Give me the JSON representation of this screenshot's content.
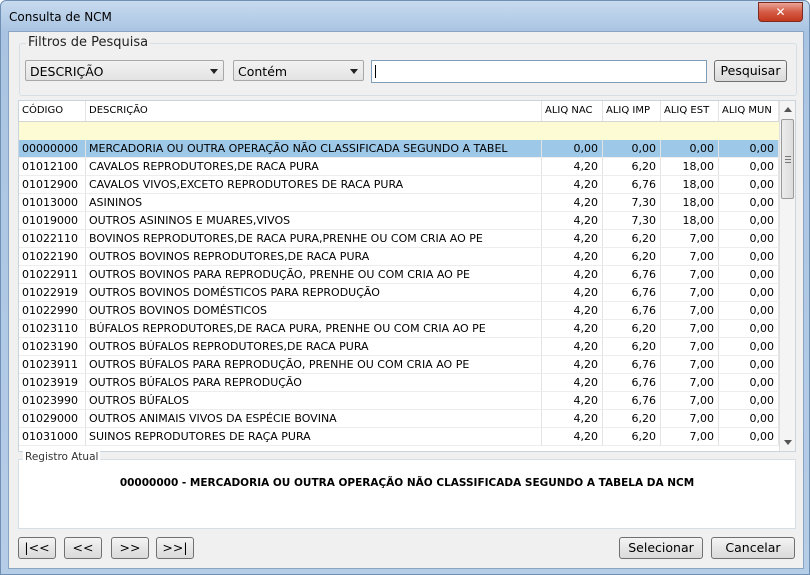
{
  "window": {
    "title": "Consulta de NCM",
    "close_glyph": "✕",
    "close_icon": "close-icon"
  },
  "filters": {
    "legend": "Filtros de Pesquisa",
    "field_select": "DESCRIÇÃO",
    "mode_select": "Contém",
    "search_value": "",
    "search_button": "Pesquisar"
  },
  "grid": {
    "columns": [
      "CÓDIGO",
      "DESCRIÇÃO",
      "ALIQ NAC",
      "ALIQ IMP",
      "ALIQ EST",
      "ALIQ MUN"
    ],
    "selected_index": 0,
    "rows": [
      [
        "00000000",
        "MERCADORIA OU OUTRA OPERAÇÃO NÃO CLASSIFICADA SEGUNDO A TABEL",
        "0,00",
        "0,00",
        "0,00",
        "0,00"
      ],
      [
        "01012100",
        "CAVALOS REPRODUTORES,DE RACA PURA",
        "4,20",
        "6,20",
        "18,00",
        "0,00"
      ],
      [
        "01012900",
        "CAVALOS VIVOS,EXCETO REPRODUTORES DE RACA PURA",
        "4,20",
        "6,76",
        "18,00",
        "0,00"
      ],
      [
        "01013000",
        "ASININOS",
        "4,20",
        "7,30",
        "18,00",
        "0,00"
      ],
      [
        "01019000",
        "OUTROS ASININOS E MUARES,VIVOS",
        "4,20",
        "7,30",
        "18,00",
        "0,00"
      ],
      [
        "01022110",
        "BOVINOS REPRODUTORES,DE RACA PURA,PRENHE OU COM CRIA AO PE",
        "4,20",
        "6,20",
        "7,00",
        "0,00"
      ],
      [
        "01022190",
        "OUTROS BOVINOS REPRODUTORES,DE RACA PURA",
        "4,20",
        "6,20",
        "7,00",
        "0,00"
      ],
      [
        "01022911",
        "OUTROS BOVINOS PARA REPRODUÇÃO, PRENHE OU COM CRIA AO PE",
        "4,20",
        "6,76",
        "7,00",
        "0,00"
      ],
      [
        "01022919",
        "OUTROS BOVINOS DOMÉSTICOS PARA REPRODUÇÃO",
        "4,20",
        "6,76",
        "7,00",
        "0,00"
      ],
      [
        "01022990",
        "OUTROS BOVINOS DOMÉSTICOS",
        "4,20",
        "6,76",
        "7,00",
        "0,00"
      ],
      [
        "01023110",
        "BÚFALOS REPRODUTORES,DE RACA PURA, PRENHE OU COM CRIA AO PE",
        "4,20",
        "6,20",
        "7,00",
        "0,00"
      ],
      [
        "01023190",
        "OUTROS BÚFALOS REPRODUTORES,DE RACA PURA",
        "4,20",
        "6,20",
        "7,00",
        "0,00"
      ],
      [
        "01023911",
        "OUTROS BÚFALOS PARA REPRODUÇÃO, PRENHE OU COM CRIA AO PE",
        "4,20",
        "6,76",
        "7,00",
        "0,00"
      ],
      [
        "01023919",
        "OUTROS BÚFALOS PARA REPRODUÇÃO",
        "4,20",
        "6,76",
        "7,00",
        "0,00"
      ],
      [
        "01023990",
        "OUTROS BÚFALOS",
        "4,20",
        "6,76",
        "7,00",
        "0,00"
      ],
      [
        "01029000",
        "OUTROS ANIMAIS VIVOS DA ESPÉCIE BOVINA",
        "4,20",
        "6,20",
        "7,00",
        "0,00"
      ],
      [
        "01031000",
        "SUINOS  REPRODUTORES DE RAÇA PURA",
        "4,20",
        "6,20",
        "7,00",
        "0,00"
      ]
    ]
  },
  "registro": {
    "label": "Registro Atual",
    "text": "00000000 - MERCADORIA OU OUTRA OPERAÇÃO NÃO CLASSIFICADA SEGUNDO A TABELA DA NCM"
  },
  "nav": {
    "first": "|<<",
    "prev": "<<",
    "next": ">>",
    "last": ">>|"
  },
  "actions": {
    "select": "Selecionar",
    "cancel": "Cancelar"
  },
  "colors": {
    "selected_row": "#9dc8e8",
    "filter_row": "#fdfbd4"
  }
}
